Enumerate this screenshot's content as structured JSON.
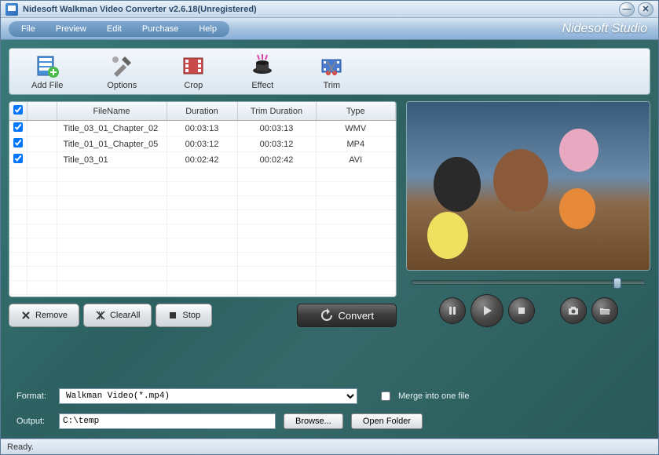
{
  "window": {
    "title": "Nidesoft Walkman Video Converter v2.6.18(Unregistered)"
  },
  "menubar": {
    "items": [
      "File",
      "Preview",
      "Edit",
      "Purchase",
      "Help"
    ],
    "brand": "Nidesoft Studio"
  },
  "toolbar": {
    "items": [
      {
        "label": "Add File",
        "icon": "add-file-icon"
      },
      {
        "label": "Options",
        "icon": "options-icon"
      },
      {
        "label": "Crop",
        "icon": "crop-icon"
      },
      {
        "label": "Effect",
        "icon": "effect-icon"
      },
      {
        "label": "Trim",
        "icon": "trim-icon"
      }
    ]
  },
  "table": {
    "headers": {
      "filename": "FileName",
      "duration": "Duration",
      "trim": "Trim Duration",
      "type": "Type"
    },
    "rows": [
      {
        "checked": true,
        "filename": "Title_03_01_Chapter_02",
        "duration": "00:03:13",
        "trim": "00:03:13",
        "type": "WMV"
      },
      {
        "checked": true,
        "filename": "Title_01_01_Chapter_05",
        "duration": "00:03:12",
        "trim": "00:03:12",
        "type": "MP4"
      },
      {
        "checked": true,
        "filename": "Title_03_01",
        "duration": "00:02:42",
        "trim": "00:02:42",
        "type": "AVI"
      }
    ]
  },
  "actions": {
    "remove": "Remove",
    "clear": "ClearAll",
    "stop": "Stop",
    "convert": "Convert"
  },
  "settings": {
    "format_label": "Format:",
    "format_value": "Walkman Video(*.mp4)",
    "output_label": "Output:",
    "output_value": "C:\\temp",
    "browse": "Browse...",
    "openfolder": "Open Folder",
    "merge_label": "Merge into one file",
    "merge_checked": false
  },
  "status": {
    "text": "Ready."
  }
}
